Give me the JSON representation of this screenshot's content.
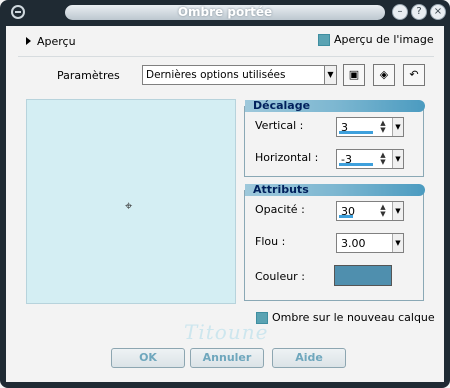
{
  "window": {
    "title": "Ombre portée",
    "minimize_icon": "minimize-icon",
    "help_icon": "help-icon",
    "close_icon": "close-icon"
  },
  "preview_toggle": {
    "label": "Aperçu"
  },
  "preview_on_image": {
    "label": "Aperçu de l'image",
    "checked": true
  },
  "params": {
    "label": "Paramètres",
    "preset_value": "Dernières options utilisées",
    "save_icon": "save-icon",
    "delete_icon": "delete-icon",
    "reset_icon": "reset-icon"
  },
  "decalage": {
    "title": "Décalage",
    "vertical_label": "Vertical :",
    "vertical_value": "3",
    "horizontal_label": "Horizontal :",
    "horizontal_value": "-3"
  },
  "attributs": {
    "title": "Attributs",
    "opacity_label": "Opacité :",
    "opacity_value": "30",
    "blur_label": "Flou :",
    "blur_value": "3.00",
    "color_label": "Couleur :",
    "color_value": "#4f8fae"
  },
  "shadow_new_layer": {
    "label": "Ombre sur le nouveau calque",
    "checked": true
  },
  "watermark": "Titoune",
  "buttons": {
    "ok": "OK",
    "cancel": "Annuler",
    "help": "Aide"
  }
}
